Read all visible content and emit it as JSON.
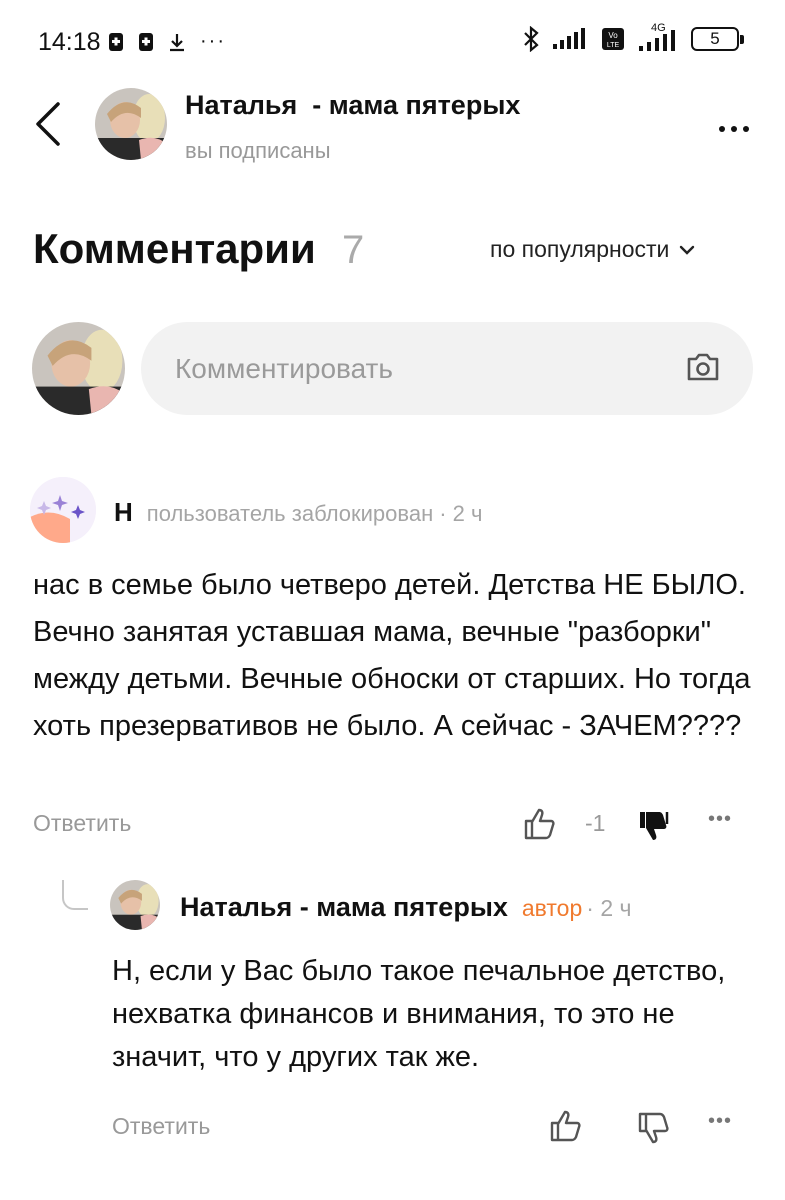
{
  "status_bar": {
    "time": "14:18",
    "battery": "5",
    "network": "4G"
  },
  "header": {
    "author_name": "Наталья  - мама пятерых",
    "subtitle": "вы подписаны",
    "more": "..."
  },
  "comments_section": {
    "title": "Комментарии",
    "count": "7",
    "sort_label": "по популярности"
  },
  "comment_input": {
    "placeholder": "Комментировать"
  },
  "comments": [
    {
      "author_initial": "Н",
      "author_status": "пользователь заблокирован",
      "time": "· 2 ч",
      "text": "нас в семье было четверо детей. Детства НЕ БЫЛО. Вечно занятая уставшая мама, вечные \"разборки\" между детьми. Вечные обноски от старших. Но тогда хоть презервативов не было. А сейчас - ЗАЧЕМ????",
      "reply_label": "Ответить",
      "rating": "-1",
      "more": "•••"
    }
  ],
  "reply": {
    "author_name": "Наталья - мама пятерых",
    "badge": "автор",
    "time": "· 2 ч",
    "text": "Н, если у Вас было такое печальное детство, нехватка финансов и внимания, то это не значит, что у других так же.",
    "reply_label": "Ответить",
    "more": "•••"
  },
  "colors": {
    "accent_orange": "#f07a2e",
    "muted_text": "#999999",
    "input_bg": "#f2f2f2"
  }
}
